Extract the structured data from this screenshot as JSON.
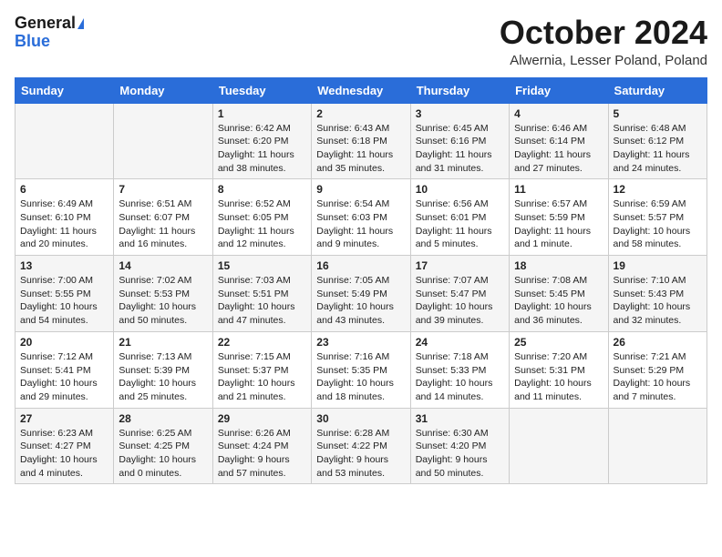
{
  "header": {
    "logo_general": "General",
    "logo_blue": "Blue",
    "title": "October 2024",
    "subtitle": "Alwernia, Lesser Poland, Poland"
  },
  "weekdays": [
    "Sunday",
    "Monday",
    "Tuesday",
    "Wednesday",
    "Thursday",
    "Friday",
    "Saturday"
  ],
  "weeks": [
    [
      {
        "day": "",
        "info": ""
      },
      {
        "day": "",
        "info": ""
      },
      {
        "day": "1",
        "info": "Sunrise: 6:42 AM\nSunset: 6:20 PM\nDaylight: 11 hours and 38 minutes."
      },
      {
        "day": "2",
        "info": "Sunrise: 6:43 AM\nSunset: 6:18 PM\nDaylight: 11 hours and 35 minutes."
      },
      {
        "day": "3",
        "info": "Sunrise: 6:45 AM\nSunset: 6:16 PM\nDaylight: 11 hours and 31 minutes."
      },
      {
        "day": "4",
        "info": "Sunrise: 6:46 AM\nSunset: 6:14 PM\nDaylight: 11 hours and 27 minutes."
      },
      {
        "day": "5",
        "info": "Sunrise: 6:48 AM\nSunset: 6:12 PM\nDaylight: 11 hours and 24 minutes."
      }
    ],
    [
      {
        "day": "6",
        "info": "Sunrise: 6:49 AM\nSunset: 6:10 PM\nDaylight: 11 hours and 20 minutes."
      },
      {
        "day": "7",
        "info": "Sunrise: 6:51 AM\nSunset: 6:07 PM\nDaylight: 11 hours and 16 minutes."
      },
      {
        "day": "8",
        "info": "Sunrise: 6:52 AM\nSunset: 6:05 PM\nDaylight: 11 hours and 12 minutes."
      },
      {
        "day": "9",
        "info": "Sunrise: 6:54 AM\nSunset: 6:03 PM\nDaylight: 11 hours and 9 minutes."
      },
      {
        "day": "10",
        "info": "Sunrise: 6:56 AM\nSunset: 6:01 PM\nDaylight: 11 hours and 5 minutes."
      },
      {
        "day": "11",
        "info": "Sunrise: 6:57 AM\nSunset: 5:59 PM\nDaylight: 11 hours and 1 minute."
      },
      {
        "day": "12",
        "info": "Sunrise: 6:59 AM\nSunset: 5:57 PM\nDaylight: 10 hours and 58 minutes."
      }
    ],
    [
      {
        "day": "13",
        "info": "Sunrise: 7:00 AM\nSunset: 5:55 PM\nDaylight: 10 hours and 54 minutes."
      },
      {
        "day": "14",
        "info": "Sunrise: 7:02 AM\nSunset: 5:53 PM\nDaylight: 10 hours and 50 minutes."
      },
      {
        "day": "15",
        "info": "Sunrise: 7:03 AM\nSunset: 5:51 PM\nDaylight: 10 hours and 47 minutes."
      },
      {
        "day": "16",
        "info": "Sunrise: 7:05 AM\nSunset: 5:49 PM\nDaylight: 10 hours and 43 minutes."
      },
      {
        "day": "17",
        "info": "Sunrise: 7:07 AM\nSunset: 5:47 PM\nDaylight: 10 hours and 39 minutes."
      },
      {
        "day": "18",
        "info": "Sunrise: 7:08 AM\nSunset: 5:45 PM\nDaylight: 10 hours and 36 minutes."
      },
      {
        "day": "19",
        "info": "Sunrise: 7:10 AM\nSunset: 5:43 PM\nDaylight: 10 hours and 32 minutes."
      }
    ],
    [
      {
        "day": "20",
        "info": "Sunrise: 7:12 AM\nSunset: 5:41 PM\nDaylight: 10 hours and 29 minutes."
      },
      {
        "day": "21",
        "info": "Sunrise: 7:13 AM\nSunset: 5:39 PM\nDaylight: 10 hours and 25 minutes."
      },
      {
        "day": "22",
        "info": "Sunrise: 7:15 AM\nSunset: 5:37 PM\nDaylight: 10 hours and 21 minutes."
      },
      {
        "day": "23",
        "info": "Sunrise: 7:16 AM\nSunset: 5:35 PM\nDaylight: 10 hours and 18 minutes."
      },
      {
        "day": "24",
        "info": "Sunrise: 7:18 AM\nSunset: 5:33 PM\nDaylight: 10 hours and 14 minutes."
      },
      {
        "day": "25",
        "info": "Sunrise: 7:20 AM\nSunset: 5:31 PM\nDaylight: 10 hours and 11 minutes."
      },
      {
        "day": "26",
        "info": "Sunrise: 7:21 AM\nSunset: 5:29 PM\nDaylight: 10 hours and 7 minutes."
      }
    ],
    [
      {
        "day": "27",
        "info": "Sunrise: 6:23 AM\nSunset: 4:27 PM\nDaylight: 10 hours and 4 minutes."
      },
      {
        "day": "28",
        "info": "Sunrise: 6:25 AM\nSunset: 4:25 PM\nDaylight: 10 hours and 0 minutes."
      },
      {
        "day": "29",
        "info": "Sunrise: 6:26 AM\nSunset: 4:24 PM\nDaylight: 9 hours and 57 minutes."
      },
      {
        "day": "30",
        "info": "Sunrise: 6:28 AM\nSunset: 4:22 PM\nDaylight: 9 hours and 53 minutes."
      },
      {
        "day": "31",
        "info": "Sunrise: 6:30 AM\nSunset: 4:20 PM\nDaylight: 9 hours and 50 minutes."
      },
      {
        "day": "",
        "info": ""
      },
      {
        "day": "",
        "info": ""
      }
    ]
  ]
}
